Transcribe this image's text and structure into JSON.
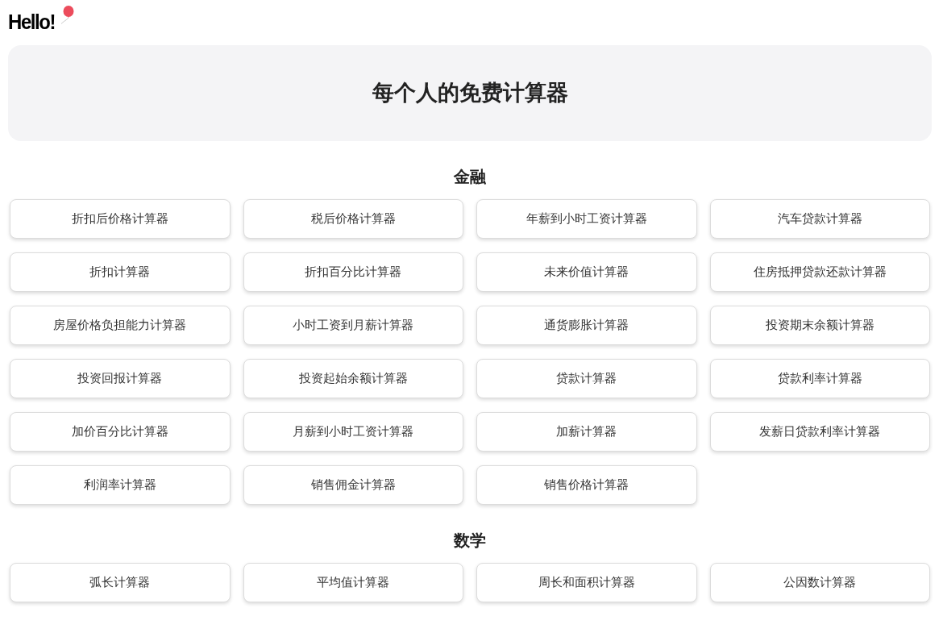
{
  "logo": {
    "text": "Hello!"
  },
  "hero": {
    "title": "每个人的免费计算器"
  },
  "sections": [
    {
      "heading": "金融",
      "calculators": [
        "折扣后价格计算器",
        "税后价格计算器",
        "年薪到小时工资计算器",
        "汽车贷款计算器",
        "折扣计算器",
        "折扣百分比计算器",
        "未来价值计算器",
        "住房抵押贷款还款计算器",
        "房屋价格负担能力计算器",
        "小时工资到月薪计算器",
        "通货膨胀计算器",
        "投资期末余额计算器",
        "投资回报计算器",
        "投资起始余额计算器",
        "贷款计算器",
        "贷款利率计算器",
        "加价百分比计算器",
        "月薪到小时工资计算器",
        "加薪计算器",
        "发薪日贷款利率计算器",
        "利润率计算器",
        "销售佣金计算器",
        "销售价格计算器"
      ]
    },
    {
      "heading": "数学",
      "calculators": [
        "弧长计算器",
        "平均值计算器",
        "周长和面积计算器",
        "公因数计算器"
      ]
    }
  ]
}
